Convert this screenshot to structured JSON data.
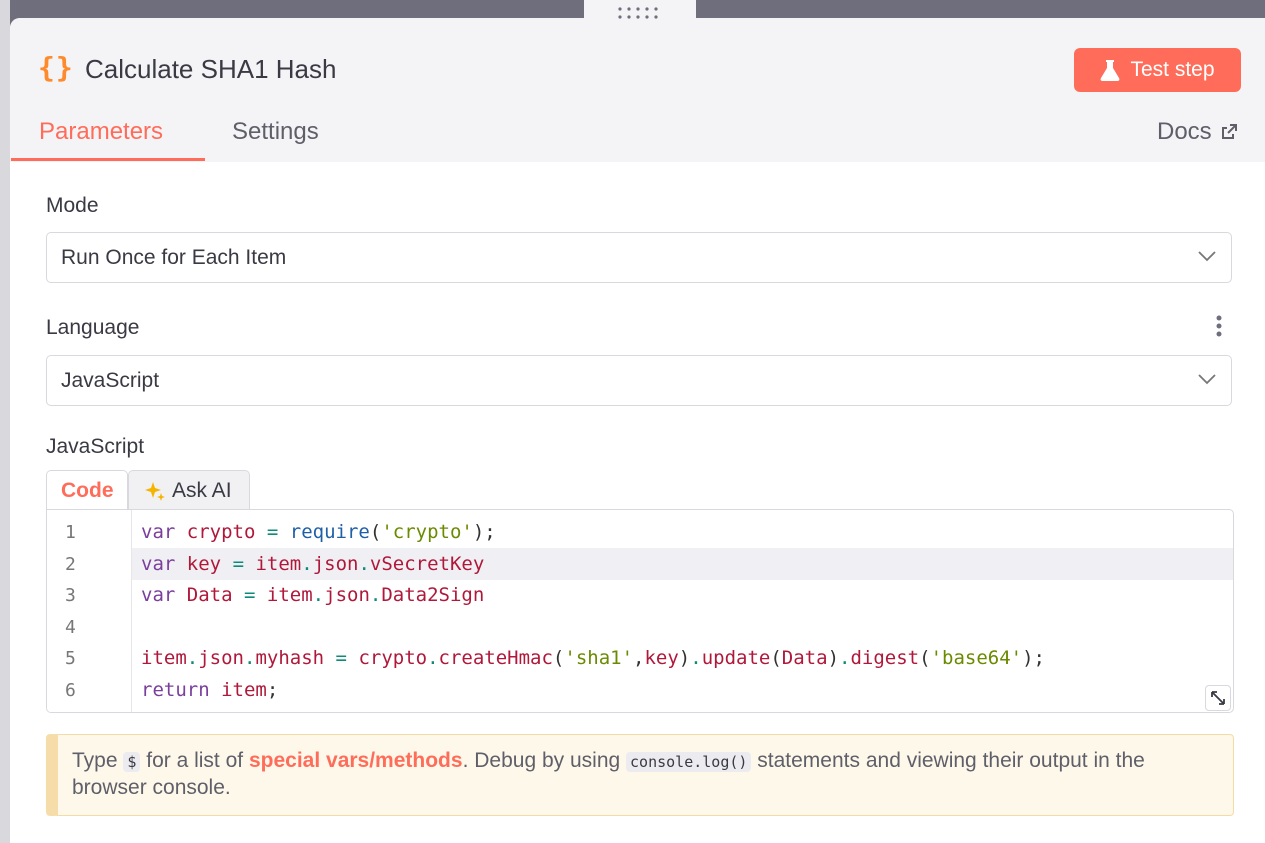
{
  "node": {
    "title": "Calculate SHA1 Hash",
    "icon": "code-braces-icon",
    "icon_glyph": "{}"
  },
  "header": {
    "test_button_label": "Test step",
    "tabs": [
      {
        "label": "Parameters",
        "active": true
      },
      {
        "label": "Settings",
        "active": false
      }
    ],
    "docs_label": "Docs"
  },
  "fields": {
    "mode": {
      "label": "Mode",
      "value": "Run Once for Each Item"
    },
    "language": {
      "label": "Language",
      "value": "JavaScript"
    },
    "code_label": "JavaScript"
  },
  "editor": {
    "tabs": [
      {
        "label": "Code",
        "active": true
      },
      {
        "label": "Ask AI",
        "icon": "sparkles-icon",
        "active": false
      }
    ],
    "line_numbers": [
      "1",
      "2",
      "3",
      "4",
      "5",
      "6"
    ],
    "active_line": 2
  },
  "hint": {
    "pre": "Type",
    "dollar": "$",
    "mid": "for a list of",
    "link": "special vars/methods",
    "post": ". Debug by using",
    "console": "console.log()",
    "end": "statements and viewing their output in the browser console."
  },
  "colors": {
    "accent": "#ff6d5a",
    "icon_orange": "#ff8a2b",
    "header_bg": "#f4f4f7",
    "hint_bg": "#fef8ea"
  }
}
